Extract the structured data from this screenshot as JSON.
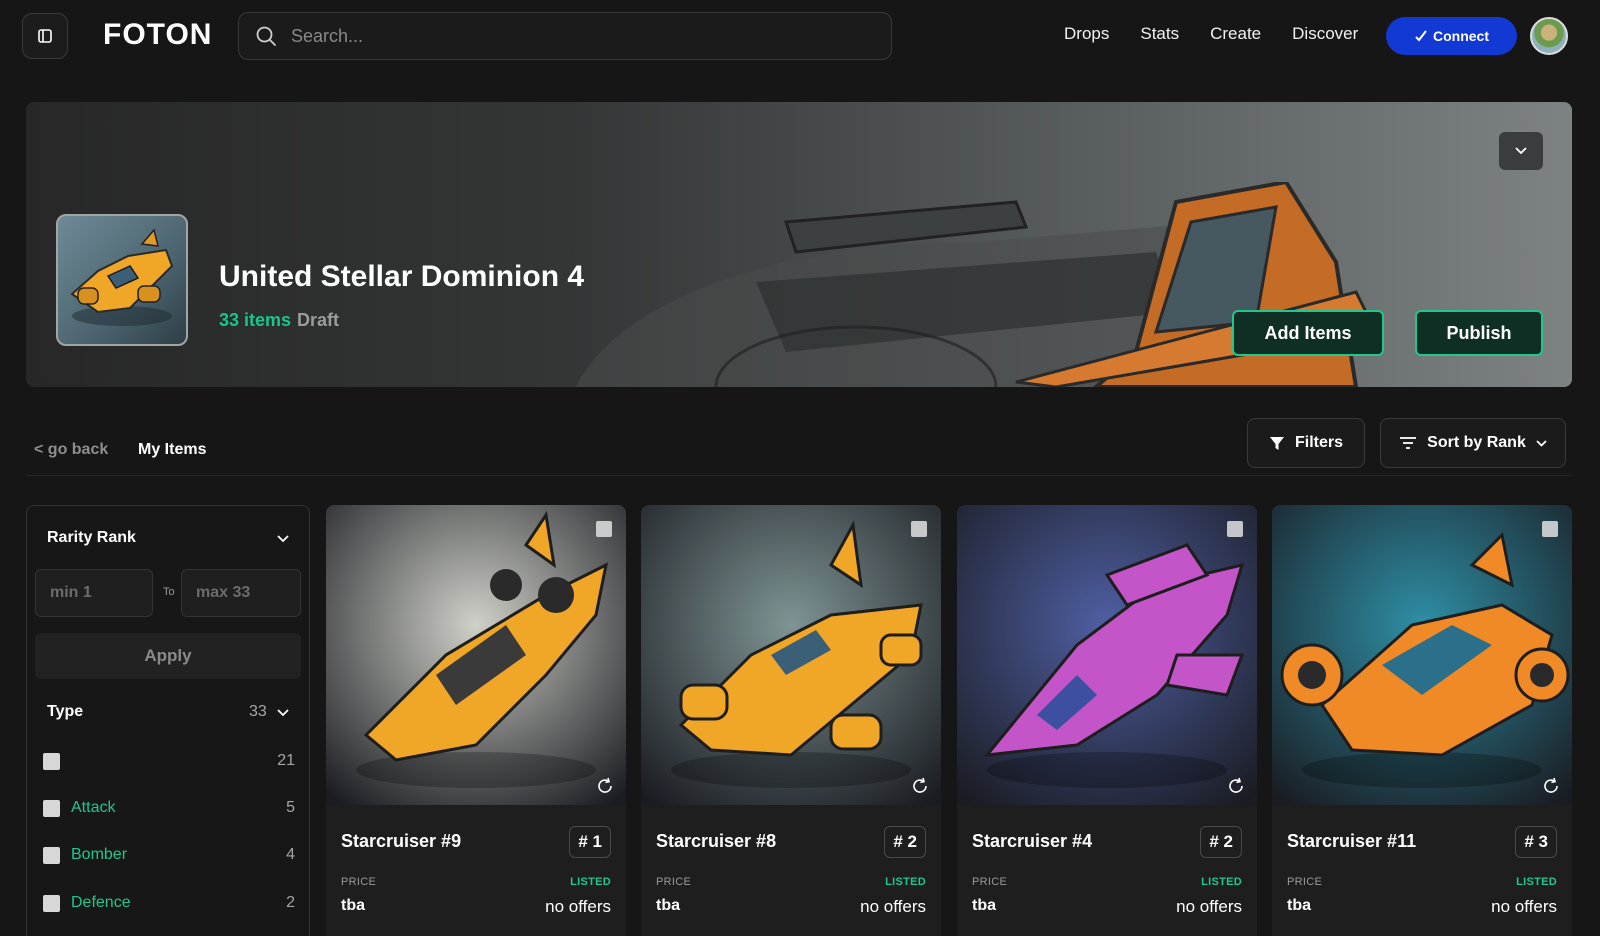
{
  "nav": {
    "logo": "FOTON",
    "search_placeholder": "Search...",
    "links": [
      "Drops",
      "Stats",
      "Create",
      "Discover"
    ],
    "connect_label": "Connect",
    "accent": "#1339d4"
  },
  "collection": {
    "title": "United Stellar Dominion 4",
    "items_count": "33 items",
    "status": "Draft",
    "add_items_label": "Add Items",
    "publish_label": "Publish"
  },
  "toolbar": {
    "go_back": "< go back",
    "my_items": "My Items",
    "filters_label": "Filters",
    "sort_label": "Sort by Rank"
  },
  "sidebar": {
    "rarity_title": "Rarity Rank",
    "min_placeholder": "min 1",
    "to_label": "To",
    "max_placeholder": "max 33",
    "apply_label": "Apply",
    "type_title": "Type",
    "type_total": "33",
    "types": [
      {
        "label": "",
        "count": "21"
      },
      {
        "label": "Attack",
        "count": "5"
      },
      {
        "label": "Bomber",
        "count": "4"
      },
      {
        "label": "Defence",
        "count": "2"
      }
    ]
  },
  "cards": [
    {
      "name": "Starcruiser #9",
      "rank": "# 1",
      "price_label": "PRICE",
      "status": "LISTED",
      "price": "tba",
      "offers": "no offers",
      "bg": "#cfd0c8",
      "ship": "#f0a626"
    },
    {
      "name": "Starcruiser #8",
      "rank": "# 2",
      "price_label": "PRICE",
      "status": "LISTED",
      "price": "tba",
      "offers": "no offers",
      "bg": "#7f9494",
      "ship": "#f0a626"
    },
    {
      "name": "Starcruiser #4",
      "rank": "# 2",
      "price_label": "PRICE",
      "status": "LISTED",
      "price": "tba",
      "offers": "no offers",
      "bg": "#4f5fa3",
      "ship": "#c355c8"
    },
    {
      "name": "Starcruiser #11",
      "rank": "# 3",
      "price_label": "PRICE",
      "status": "LISTED",
      "price": "tba",
      "offers": "no offers",
      "bg": "#2e8fa6",
      "ship": "#f08a26"
    }
  ]
}
